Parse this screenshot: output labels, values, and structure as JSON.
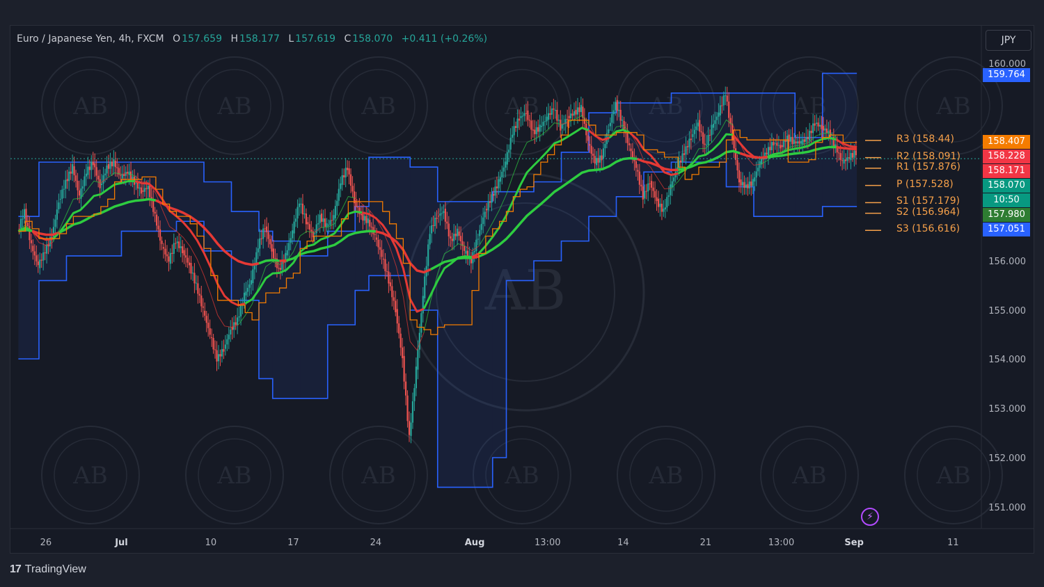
{
  "header": {
    "symbol": "Euro / Japanese Yen, 4h, FXCM",
    "open_label": "O",
    "open": "157.659",
    "high_label": "H",
    "high": "158.177",
    "low_label": "L",
    "low": "157.619",
    "close_label": "C",
    "close": "158.070",
    "change": "+0.411 (+0.26%)",
    "currency_button": "JPY"
  },
  "branding": {
    "logo_text": "TradingView",
    "logo_mark": "17",
    "watermark_text": "AB"
  },
  "colors": {
    "up": "#26a69a",
    "down": "#ef5350",
    "ema_fast": "#2ecc40",
    "ema_slow": "#e53935",
    "band": "#2962ff",
    "kijun": "#f57c00",
    "pivot": "#f7a14a"
  },
  "chart_data": {
    "type": "line",
    "ylim": [
      150.5,
      160.5
    ],
    "y_ticks": [
      "160.000",
      "156.000",
      "155.000",
      "154.000",
      "153.000",
      "152.000",
      "151.000"
    ],
    "x_ticks": [
      {
        "label": "26",
        "x": 0.5,
        "bold": false
      },
      {
        "label": "Jul",
        "x": 6,
        "bold": true
      },
      {
        "label": "10",
        "x": 12.5,
        "bold": false
      },
      {
        "label": "17",
        "x": 18.5,
        "bold": false
      },
      {
        "label": "24",
        "x": 24.5,
        "bold": false
      },
      {
        "label": "Aug",
        "x": 31.7,
        "bold": true
      },
      {
        "label": "13:00",
        "x": 37,
        "bold": false
      },
      {
        "label": "14",
        "x": 42.5,
        "bold": false
      },
      {
        "label": "21",
        "x": 48.5,
        "bold": false
      },
      {
        "label": "13:00",
        "x": 54,
        "bold": false
      },
      {
        "label": "Sep",
        "x": 59.3,
        "bold": true
      },
      {
        "label": "11",
        "x": 66.5,
        "bold": false
      }
    ],
    "close_series": {
      "x": [
        -1.5,
        -1,
        -0.5,
        0,
        0.5,
        1,
        1.5,
        2,
        2.5,
        3,
        3.5,
        4,
        4.5,
        5,
        5.5,
        6,
        6.5,
        7,
        7.5,
        8,
        8.5,
        9,
        9.5,
        10,
        10.5,
        11,
        11.5,
        12,
        12.5,
        13,
        13.5,
        14,
        14.5,
        15,
        15.5,
        16,
        16.5,
        17,
        17.5,
        18,
        18.5,
        19,
        19.5,
        20,
        20.5,
        21,
        21.5,
        22,
        22.5,
        23,
        23.5,
        24,
        24.5,
        25,
        25.5,
        26,
        26.5,
        27,
        27.5,
        28,
        28.5,
        29,
        29.5,
        30,
        30.5,
        31,
        31.5,
        32,
        32.5,
        33,
        33.5,
        34,
        34.5,
        35,
        35.5,
        36,
        36.5,
        37,
        37.5,
        38,
        38.5,
        39,
        39.5,
        40,
        40.5,
        41,
        41.5,
        42,
        42.5,
        43,
        43.5,
        44,
        44.5,
        45,
        45.5,
        46,
        46.5,
        47,
        47.5,
        48,
        48.5,
        49,
        49.5,
        50,
        50.5,
        51,
        51.5,
        52,
        52.5,
        53,
        53.5,
        54,
        54.5,
        55,
        55.5,
        56,
        56.5,
        57,
        57.5,
        58,
        58.5,
        59,
        59.5
      ],
      "y": [
        156.6,
        157.0,
        156.3,
        155.9,
        156.2,
        156.5,
        157.2,
        157.6,
        157.9,
        157.3,
        157.8,
        158.0,
        157.5,
        157.9,
        158.0,
        157.7,
        157.8,
        157.6,
        157.4,
        157.5,
        156.9,
        156.3,
        156.0,
        156.4,
        156.2,
        155.9,
        155.5,
        155.0,
        154.5,
        154.0,
        154.2,
        154.6,
        154.8,
        155.3,
        155.6,
        156.3,
        156.7,
        156.2,
        155.8,
        156.1,
        156.6,
        157.2,
        156.8,
        156.5,
        156.9,
        156.7,
        156.9,
        157.6,
        157.9,
        157.2,
        156.9,
        156.8,
        156.5,
        156.1,
        155.6,
        155.0,
        154.0,
        152.4,
        153.8,
        155.3,
        156.6,
        156.9,
        157.0,
        156.4,
        156.6,
        156.2,
        156.0,
        156.5,
        157.0,
        157.3,
        157.6,
        158.0,
        158.6,
        158.9,
        159.0,
        158.6,
        158.7,
        158.9,
        159.1,
        158.7,
        158.9,
        159.0,
        159.1,
        158.4,
        158.0,
        158.1,
        158.7,
        159.2,
        158.8,
        158.3,
        157.9,
        157.3,
        157.6,
        157.2,
        157.0,
        157.5,
        157.9,
        158.2,
        158.5,
        158.8,
        158.3,
        158.7,
        159.0,
        159.4,
        158.5,
        157.6,
        157.5,
        157.6,
        158.0,
        158.2,
        158.4,
        158.3,
        158.5,
        158.4,
        158.4,
        158.5,
        158.8,
        158.7,
        158.6,
        158.3,
        158.0,
        158.1,
        158.2
      ]
    }
  },
  "indicators": {
    "bands": [
      {
        "top": 156.9,
        "bottom": 154.0,
        "from": -1.5,
        "to": 0
      },
      {
        "top": 158.0,
        "bottom": 155.6,
        "from": 0,
        "to": 2
      },
      {
        "top": 158.0,
        "bottom": 156.1,
        "from": 2,
        "to": 6
      },
      {
        "top": 158.0,
        "bottom": 156.6,
        "from": 6,
        "to": 10
      },
      {
        "top": 158.0,
        "bottom": 156.8,
        "from": 10,
        "to": 12
      },
      {
        "top": 157.6,
        "bottom": 156.2,
        "from": 12,
        "to": 14
      },
      {
        "top": 157.0,
        "bottom": 155.2,
        "from": 14,
        "to": 16
      },
      {
        "top": 156.6,
        "bottom": 153.6,
        "from": 16,
        "to": 17
      },
      {
        "top": 156.4,
        "bottom": 153.2,
        "from": 17,
        "to": 19
      },
      {
        "top": 156.1,
        "bottom": 153.2,
        "from": 19,
        "to": 21
      },
      {
        "top": 156.6,
        "bottom": 154.7,
        "from": 21,
        "to": 23
      },
      {
        "top": 157.1,
        "bottom": 155.4,
        "from": 23,
        "to": 24
      },
      {
        "top": 158.1,
        "bottom": 155.7,
        "from": 24,
        "to": 27
      },
      {
        "top": 157.9,
        "bottom": 155.0,
        "from": 27,
        "to": 29
      },
      {
        "top": 157.2,
        "bottom": 151.4,
        "from": 29,
        "to": 33
      },
      {
        "top": 157.4,
        "bottom": 152.0,
        "from": 33,
        "to": 34
      },
      {
        "top": 157.4,
        "bottom": 155.6,
        "from": 34,
        "to": 36
      },
      {
        "top": 157.6,
        "bottom": 156.0,
        "from": 36,
        "to": 38
      },
      {
        "top": 158.2,
        "bottom": 156.4,
        "from": 38,
        "to": 40
      },
      {
        "top": 159.0,
        "bottom": 156.9,
        "from": 40,
        "to": 42
      },
      {
        "top": 159.2,
        "bottom": 157.3,
        "from": 42,
        "to": 44
      },
      {
        "top": 159.2,
        "bottom": 157.8,
        "from": 44,
        "to": 46
      },
      {
        "top": 159.4,
        "bottom": 158.0,
        "from": 46,
        "to": 50
      },
      {
        "top": 159.4,
        "bottom": 157.5,
        "from": 50,
        "to": 52
      },
      {
        "top": 159.4,
        "bottom": 156.9,
        "from": 52,
        "to": 55
      },
      {
        "top": 158.5,
        "bottom": 156.9,
        "from": 55,
        "to": 57
      },
      {
        "top": 159.8,
        "bottom": 157.1,
        "from": 57,
        "to": 59.5
      }
    ],
    "pivots": [
      {
        "label": "R3 (158.44)",
        "value": 158.44
      },
      {
        "label": "R2 (158.091)",
        "value": 158.091
      },
      {
        "label": "R1 (157.876)",
        "value": 157.876
      },
      {
        "label": "P (157.528)",
        "value": 157.528
      },
      {
        "label": "S1 (157.179)",
        "value": 157.179
      },
      {
        "label": "S2 (156.964)",
        "value": 156.964
      },
      {
        "label": "S3 (156.616)",
        "value": 156.616
      }
    ]
  },
  "price_tags": [
    {
      "text": "159.764",
      "value": 159.764,
      "color": "#2962ff"
    },
    {
      "text": "158.407",
      "value": 158.407,
      "color": "#f57c00"
    },
    {
      "text": "158.228",
      "value": 158.228,
      "color": "#f23645"
    },
    {
      "text": "158.171",
      "value": 158.171,
      "color": "#f23645"
    },
    {
      "text": "158.070",
      "value": 158.07,
      "color": "#089981"
    },
    {
      "text": "10:50",
      "value": 157.88,
      "color": "#089981"
    },
    {
      "text": "157.980",
      "value": 157.98,
      "color": "#2e7d32"
    },
    {
      "text": "157.051",
      "value": 157.051,
      "color": "#2962ff"
    }
  ]
}
